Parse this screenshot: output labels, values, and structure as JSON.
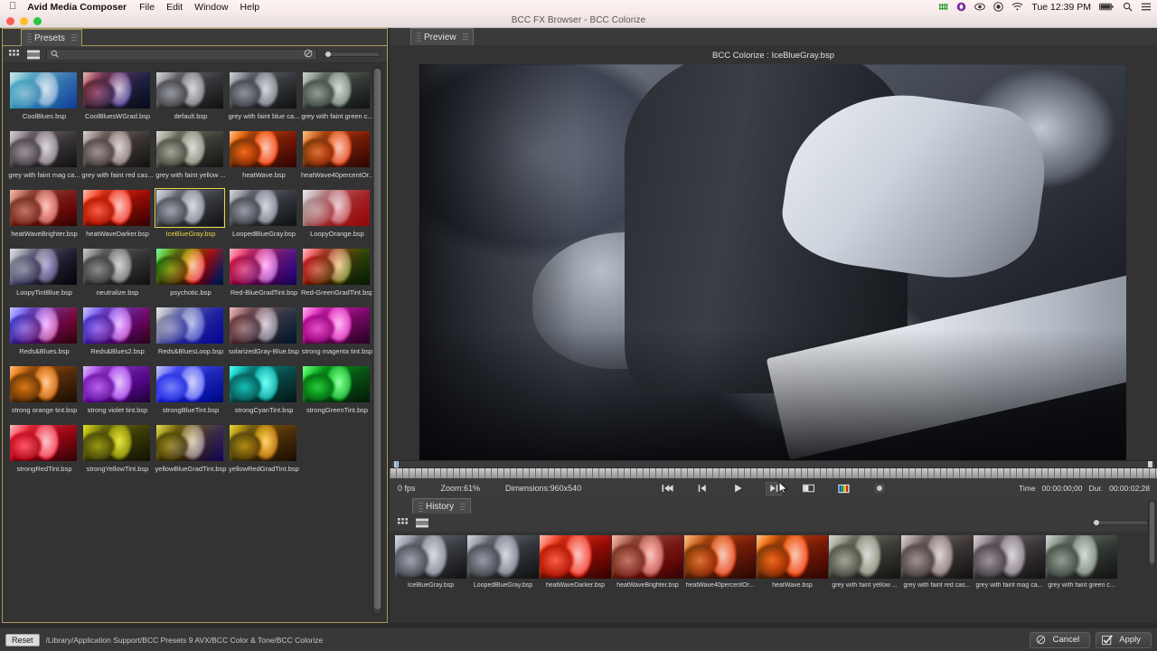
{
  "menubar": {
    "apple_icon": "apple-icon",
    "app_name": "Avid Media Composer",
    "items": [
      "File",
      "Edit",
      "Window",
      "Help"
    ],
    "status_icons": [
      "network-activity-icon",
      "dropbox-icon",
      "eye-icon",
      "record-icon",
      "wifi-icon"
    ],
    "clock": "Tue 12:39 PM",
    "right_icons": [
      "battery-icon",
      "search-icon",
      "notification-center-icon"
    ]
  },
  "window": {
    "title": "BCC FX Browser - BCC Colorize"
  },
  "presets": {
    "tab_label": "Presets",
    "toolbar": {
      "grid_view_icon": "grid-view-icon",
      "list_view_icon": "list-view-icon",
      "search_icon": "search-icon",
      "search_value": "",
      "search_placeholder": "",
      "clear_icon": "clear-circle-slash-icon",
      "zoom_slider_value": 3
    },
    "selected": "IceBlueGray.bsp",
    "items": [
      {
        "label": "CoolBlues.bsp",
        "tint": "linear-gradient(120deg, rgba(0,190,220,.78), rgba(0,60,200,.72))",
        "mix": "screen"
      },
      {
        "label": "CoolBluesWGrad.bsp",
        "tint": "linear-gradient(120deg, rgba(215,40,50,.62), rgba(20,70,210,.78))",
        "mix": "overlay"
      },
      {
        "label": "default.bsp",
        "tint": "linear-gradient(120deg, rgba(175,178,195,.40), rgba(120,125,150,.35))",
        "mix": "overlay"
      },
      {
        "label": "grey with faint blue ca...",
        "tint": "linear-gradient(120deg, rgba(150,170,200,.30), rgba(120,140,180,.26))",
        "mix": "overlay"
      },
      {
        "label": "grey with faint green c...",
        "tint": "linear-gradient(120deg, rgba(160,200,165,.32), rgba(120,170,130,.28))",
        "mix": "overlay"
      },
      {
        "label": "grey with faint mag ca...",
        "tint": "linear-gradient(120deg, rgba(205,165,195,.30), rgba(170,130,165,.26))",
        "mix": "overlay"
      },
      {
        "label": "grey with faint red cas...",
        "tint": "linear-gradient(120deg, rgba(215,160,155,.32), rgba(180,120,115,.26))",
        "mix": "overlay"
      },
      {
        "label": "grey with faint yellow ...",
        "tint": "linear-gradient(120deg, rgba(215,215,170,.34), rgba(185,185,130,.28))",
        "mix": "overlay"
      },
      {
        "label": "heatWave.bsp",
        "tint": "linear-gradient(120deg, rgba(255,130,20,.88), rgba(190,10,0,.9))",
        "mix": "color"
      },
      {
        "label": "heatWave40percentOr...",
        "tint": "linear-gradient(120deg, rgba(255,150,60,.8), rgba(200,25,10,.85))",
        "mix": "color"
      },
      {
        "label": "heatWaveBrighter.bsp",
        "tint": "linear-gradient(120deg, rgba(240,150,120,.72), rgba(160,30,35,.8))",
        "mix": "color"
      },
      {
        "label": "heatWaveDarker.bsp",
        "tint": "linear-gradient(120deg, rgba(255,70,35,.9), rgba(150,0,0,.92))",
        "mix": "color"
      },
      {
        "label": "IceBlueGray.bsp",
        "tint": "linear-gradient(120deg, rgba(190,200,225,.45), rgba(130,145,180,.40))",
        "mix": "overlay"
      },
      {
        "label": "LoopedBlueGray.bsp",
        "tint": "linear-gradient(120deg, rgba(175,185,210,.42), rgba(110,125,160,.42))",
        "mix": "overlay"
      },
      {
        "label": "LoopyOrange.bsp",
        "tint": "linear-gradient(120deg, rgba(255,255,255,.55), rgba(215,30,40,.8))",
        "mix": "hard-light"
      },
      {
        "label": "LoopyTintBlue.bsp",
        "tint": "linear-gradient(120deg, rgba(225,230,245,.5), rgba(35,25,85,.88))",
        "mix": "hard-light"
      },
      {
        "label": "neutralize.bsp",
        "tint": "linear-gradient(120deg, rgba(190,190,190,.35), rgba(110,110,110,.35))",
        "mix": "saturation"
      },
      {
        "label": "psychotic.bsp",
        "tint": "linear-gradient(118deg, rgba(60,220,90,.85), rgba(230,220,40,.8) 35%, rgba(230,60,60,.85) 65%, rgba(40,120,220,.85))",
        "mix": "color"
      },
      {
        "label": "Red-BlueGradTint.bsp",
        "tint": "linear-gradient(118deg, rgba(220,15,50,.88), rgba(90,60,210,.85))",
        "mix": "color"
      },
      {
        "label": "Red-GreenGradTint.bsp",
        "tint": "linear-gradient(118deg, rgba(225,20,40,.88), rgba(90,210,70,.82))",
        "mix": "color"
      },
      {
        "label": "Reds&Blues.bsp",
        "tint": "linear-gradient(118deg, rgba(30,40,200,.9), rgba(190,25,60,.85))",
        "mix": "color"
      },
      {
        "label": "Reds&Blues2.bsp",
        "tint": "linear-gradient(118deg, rgba(40,30,195,.9), rgba(175,30,120,.85))",
        "mix": "color"
      },
      {
        "label": "Reds&BluesLoop.bsp",
        "tint": "linear-gradient(118deg, rgba(255,255,255,.5), rgba(25,35,205,.9))",
        "mix": "hard-light"
      },
      {
        "label": "solarizedGray-Blue.bsp",
        "tint": "linear-gradient(118deg, rgba(215,130,130,.7), rgba(120,160,190,.7))",
        "mix": "color"
      },
      {
        "label": "strong magenta tint.bsp",
        "tint": "linear-gradient(118deg, rgba(240,40,200,.85), rgba(150,20,130,.85))",
        "mix": "color"
      },
      {
        "label": "strong orange tint.bsp",
        "tint": "linear-gradient(118deg, rgba(245,140,35,.88), rgba(190,95,15,.85))",
        "mix": "color"
      },
      {
        "label": "strong violet tint.bsp",
        "tint": "linear-gradient(118deg, rgba(160,50,230,.85), rgba(105,25,165,.85))",
        "mix": "color"
      },
      {
        "label": "strongBlueTint.bsp",
        "tint": "linear-gradient(118deg, rgba(25,35,235,.9), rgba(15,25,175,.88))",
        "mix": "color"
      },
      {
        "label": "strongCyanTint.bsp",
        "tint": "linear-gradient(118deg, rgba(25,225,215,.88), rgba(15,165,160,.85))",
        "mix": "color"
      },
      {
        "label": "strongGreenTint.bsp",
        "tint": "linear-gradient(118deg, rgba(40,225,60,.88), rgba(20,165,45,.85))",
        "mix": "color"
      },
      {
        "label": "strongRedTint.bsp",
        "tint": "linear-gradient(118deg, rgba(225,15,35,.9), rgba(160,10,25,.88))",
        "mix": "color"
      },
      {
        "label": "strongYellowTint.bsp",
        "tint": "linear-gradient(118deg, rgba(235,235,35,.88), rgba(185,185,25,.85))",
        "mix": "color"
      },
      {
        "label": "yellowBlueGradTint.bsp",
        "tint": "linear-gradient(118deg, rgba(230,215,45,.85), rgba(115,95,205,.8))",
        "mix": "color"
      },
      {
        "label": "yellowRedGradTint.bsp",
        "tint": "linear-gradient(118deg, rgba(235,210,40,.85), rgba(225,120,25,.85))",
        "mix": "color"
      }
    ]
  },
  "preview": {
    "tab_label": "Preview",
    "title": "BCC Colorize : IceBlueGray.bsp"
  },
  "transport": {
    "fps": "0 fps",
    "zoom": "Zoom:61%",
    "dimensions": "Dimensions:960x540",
    "buttons": [
      {
        "name": "go-to-start-button",
        "icon": "skip-back-icon"
      },
      {
        "name": "step-back-button",
        "icon": "step-back-icon"
      },
      {
        "name": "play-button",
        "icon": "play-icon"
      },
      {
        "name": "step-forward-button",
        "icon": "step-forward-icon"
      },
      {
        "name": "split-view-button",
        "icon": "split-screen-icon"
      },
      {
        "name": "color-bars-button",
        "icon": "color-bars-icon"
      },
      {
        "name": "render-button",
        "icon": "render-circle-icon"
      }
    ],
    "time_label": "Time",
    "time_value": "00:00:00;00",
    "duration_label": "Dur.",
    "duration_value": "00:00:02;28"
  },
  "history": {
    "tab_label": "History",
    "toolbar": {
      "grid_view_icon": "grid-view-icon",
      "list_view_icon": "list-view-icon",
      "zoom_slider_value": 2
    },
    "items": [
      {
        "label": "IceBlueGray.bsp",
        "tint": "linear-gradient(120deg, rgba(190,200,225,.45), rgba(130,145,180,.40))",
        "mix": "overlay"
      },
      {
        "label": "LoopedBlueGray.bsp",
        "tint": "linear-gradient(120deg, rgba(175,185,210,.42), rgba(110,125,160,.42))",
        "mix": "overlay"
      },
      {
        "label": "heatWaveDarker.bsp",
        "tint": "linear-gradient(120deg, rgba(255,70,35,.9), rgba(150,0,0,.92))",
        "mix": "color"
      },
      {
        "label": "heatWaveBrighter.bsp",
        "tint": "linear-gradient(120deg, rgba(240,150,120,.72), rgba(160,30,35,.8))",
        "mix": "color"
      },
      {
        "label": "heatWave40percentOr...",
        "tint": "linear-gradient(120deg, rgba(255,150,60,.8), rgba(200,25,10,.85))",
        "mix": "color"
      },
      {
        "label": "heatWave.bsp",
        "tint": "linear-gradient(120deg, rgba(255,130,20,.88), rgba(190,10,0,.9))",
        "mix": "color"
      },
      {
        "label": "grey with faint yellow ...",
        "tint": "linear-gradient(120deg, rgba(215,215,170,.34), rgba(185,185,130,.28))",
        "mix": "overlay"
      },
      {
        "label": "grey with faint red cas...",
        "tint": "linear-gradient(120deg, rgba(215,160,155,.32), rgba(180,120,115,.26))",
        "mix": "overlay"
      },
      {
        "label": "grey with faint mag ca...",
        "tint": "linear-gradient(120deg, rgba(205,165,195,.30), rgba(170,130,165,.26))",
        "mix": "overlay"
      },
      {
        "label": "grey with faint green c...",
        "tint": "linear-gradient(120deg, rgba(160,200,165,.32), rgba(120,170,130,.28))",
        "mix": "overlay"
      }
    ]
  },
  "bottom": {
    "reset_label": "Reset",
    "path": "/Library/Application Support/BCC Presets 9 AVX/BCC Color & Tone/BCC Colorize",
    "cancel_label": "Cancel",
    "cancel_icon": "circle-slash-icon",
    "apply_label": "Apply",
    "apply_icon": "checkmark-icon"
  },
  "colors": {
    "accent_yellow": "#a89a5c",
    "selection_yellow": "#e8d74a",
    "panel_bg": "#333333",
    "toolbar_bg": "#3a3a3a"
  }
}
